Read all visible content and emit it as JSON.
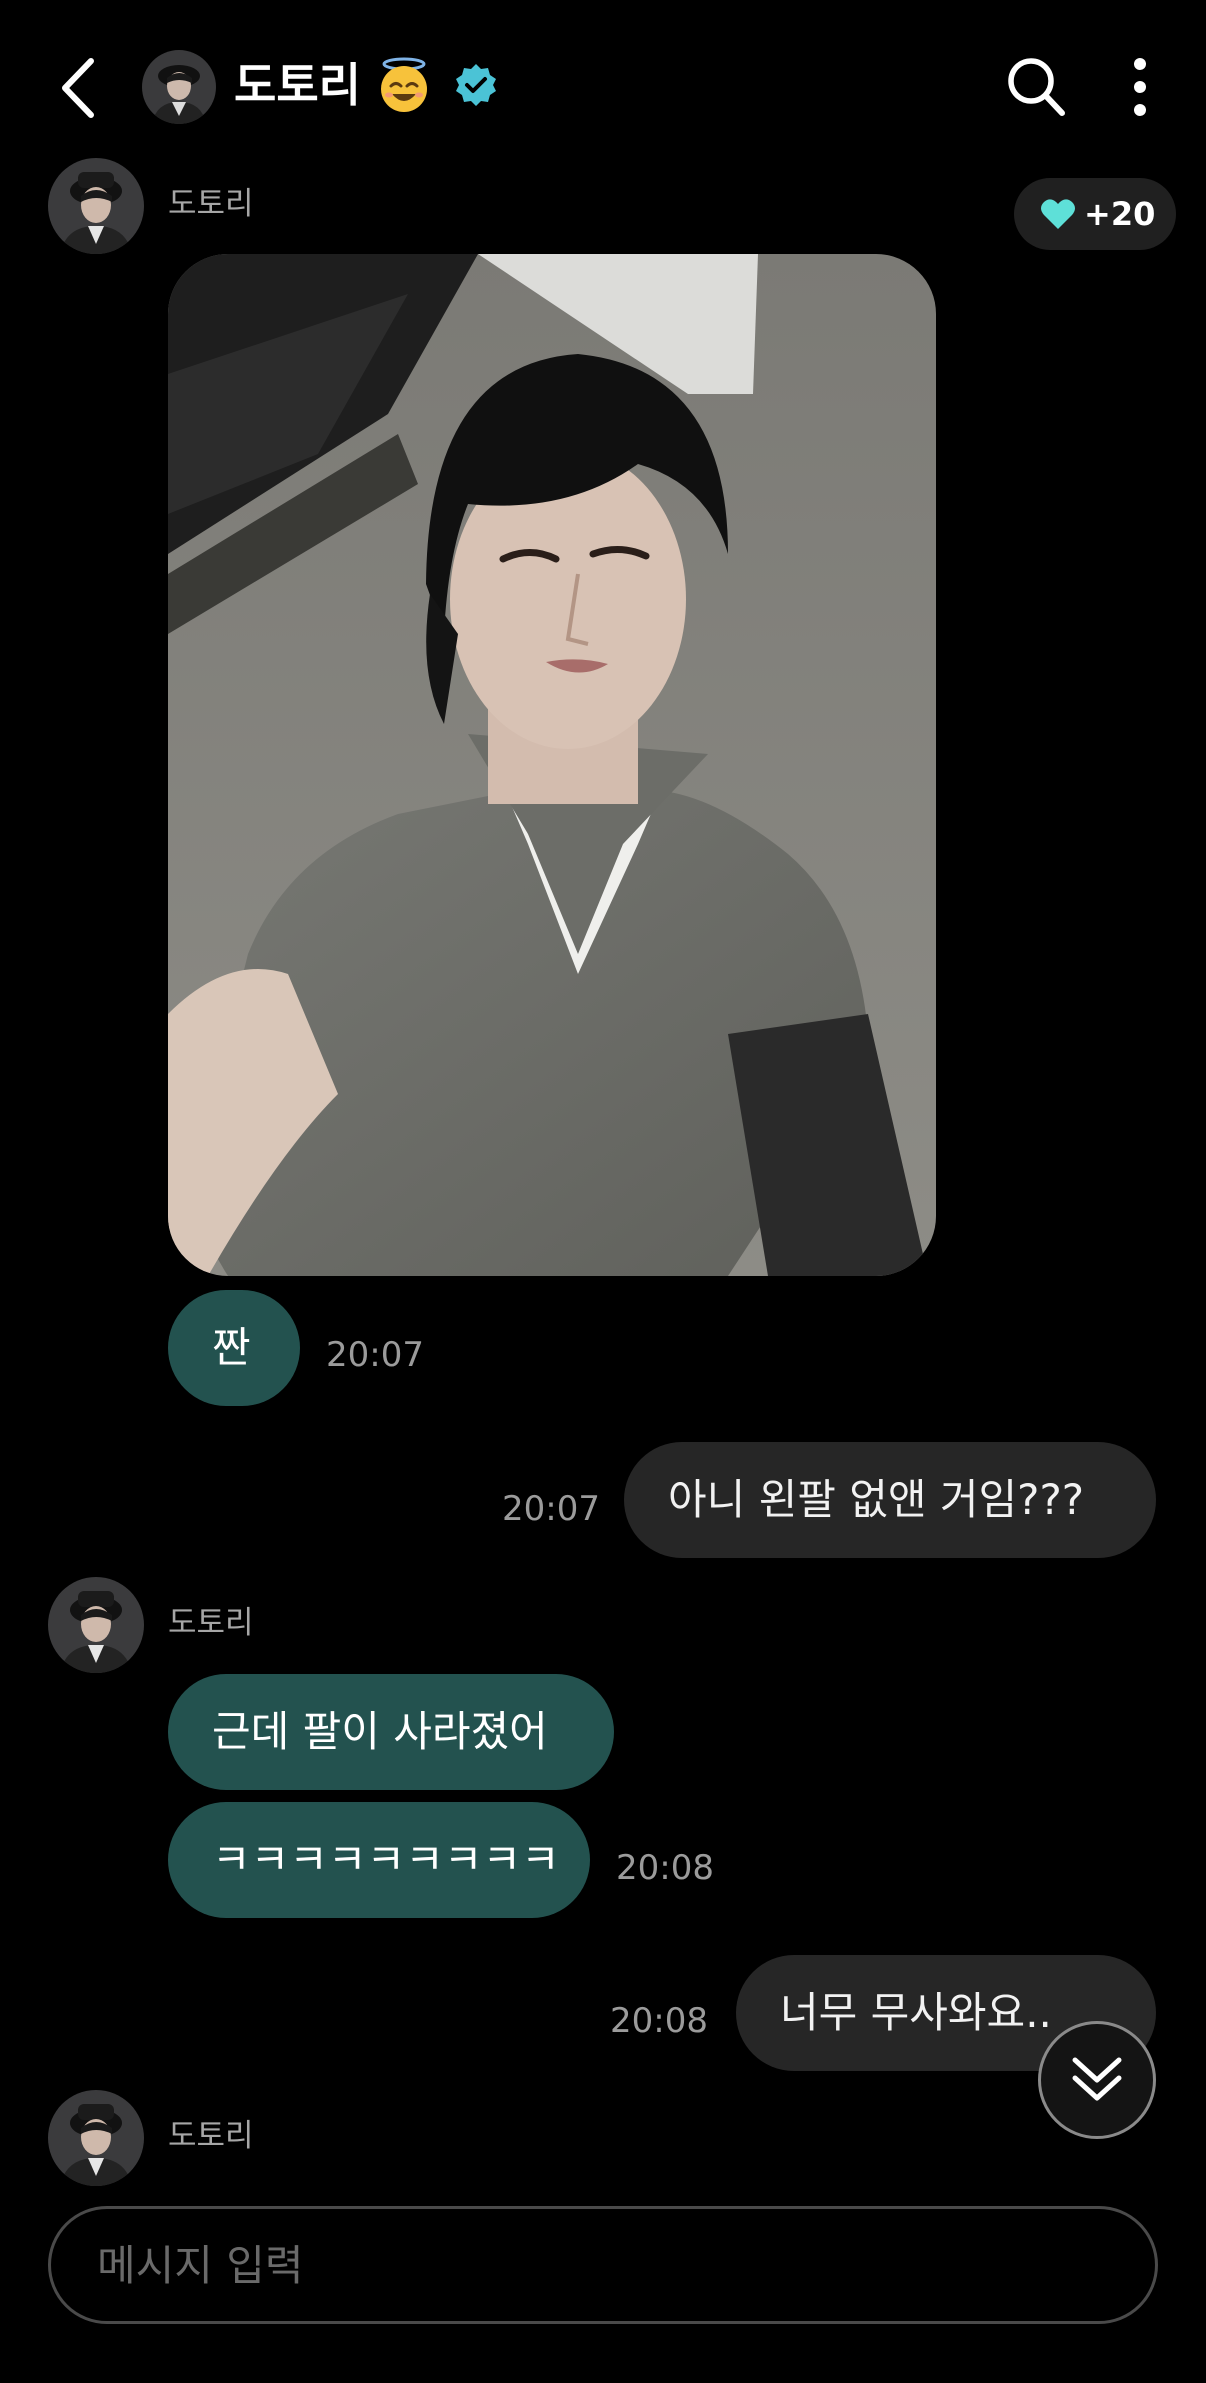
{
  "header": {
    "title": "도토리",
    "title_emoji": "smiling-face-with-halo",
    "badge": "verified-badge",
    "accent_color": "#4bc3d6"
  },
  "messages": [
    {
      "from": "artist",
      "sender": "도토리",
      "reaction": {
        "icon": "heart-icon",
        "color": "#5ee0d8",
        "count": "+20"
      },
      "photo": "selfie-photo",
      "bubbles": [
        "짠"
      ],
      "time": "20:07"
    },
    {
      "from": "me",
      "text": "아니 왼팔 없앤 거임???",
      "time": "20:07"
    },
    {
      "from": "artist",
      "sender": "도토리",
      "bubbles": [
        "근데 팔이 사라졌어",
        "ㅋㅋㅋㅋㅋㅋㅋㅋㅋ"
      ],
      "time": "20:08"
    },
    {
      "from": "me",
      "text": "너무 무사와요..",
      "time": "20:08"
    },
    {
      "from": "artist",
      "sender": "도토리"
    }
  ],
  "composer": {
    "placeholder": "메시지 입력"
  },
  "colors": {
    "background": "#000000",
    "artist_bubble": "#23524f",
    "my_bubble": "#262626"
  }
}
